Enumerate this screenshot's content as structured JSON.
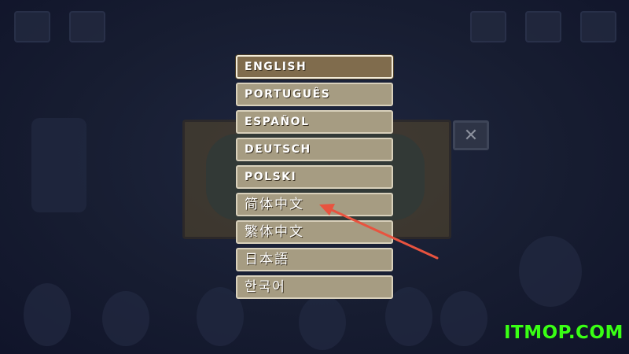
{
  "languages": [
    {
      "label": "ENGLISH",
      "selected": true
    },
    {
      "label": "PORTUGUÊS"
    },
    {
      "label": "ESPAÑOL"
    },
    {
      "label": "DEUTSCH"
    },
    {
      "label": "POLSKI"
    },
    {
      "label": "简体中文"
    },
    {
      "label": "繁体中文"
    },
    {
      "label": "日本語"
    },
    {
      "label": "한국어"
    }
  ],
  "close_button": {
    "label": "✕",
    "icon": "close-icon"
  },
  "annotation": {
    "color": "#e8533f",
    "points_to": "简体中文"
  },
  "watermark": {
    "text": "ITMOP.COM",
    "color": "#39ff14"
  },
  "colors": {
    "button": "#a69c82",
    "button_selected": "#806c4d",
    "background": "#151a2c"
  }
}
